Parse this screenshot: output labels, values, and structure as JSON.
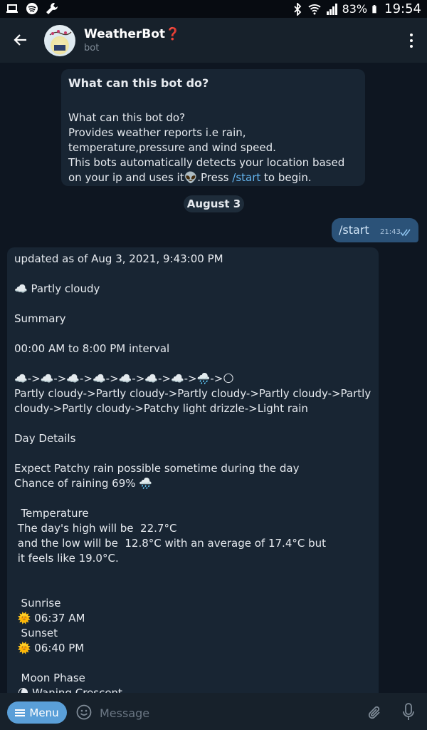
{
  "status_bar": {
    "battery_percent": "83%",
    "time": "19:54",
    "icons": [
      "laptop-icon",
      "spotify-icon",
      "wrench-icon",
      "bluetooth-icon",
      "wifi-icon",
      "signal-icon",
      "battery-icon"
    ]
  },
  "header": {
    "title": "WeatherBot❓",
    "subtitle": "bot",
    "icons": [
      "back-arrow-icon",
      "more-vert-icon"
    ]
  },
  "intro_card": {
    "title": "What can this bot do?",
    "body_before_link": "What can this bot do?\nProvides weather reports i.e rain, temperature,pressure and wind speed.\nThis bots automatically detects your location based on your ip and uses it👽.Press ",
    "link": "/start",
    "body_after_link": " to begin."
  },
  "date_separator": "August 3",
  "outgoing_message": {
    "text": "/start",
    "time": "21:43",
    "status": "read"
  },
  "incoming_message": {
    "text": "updated as of Aug 3, 2021, 9:43:00 PM\n\n☁️ Partly cloudy\n\nSummary\n\n00:00 AM to 8:00 PM interval\n\n☁️->☁️->☁️->☁️->☁️->☁️->☁️->🌧️->🌕\nPartly cloudy->Partly cloudy->Partly cloudy->Partly cloudy->Partly cloudy->Partly cloudy->Patchy light drizzle->Light rain\n\nDay Details\n\nExpect Patchy rain possible sometime during the day\nChance of raining 69% 🌧️\n\n  Temperature\n The day's high will be  22.7°C\n and the low will be  12.8°C with an average of 17.4°C but\n it feels like 19.0°C.\n\n\n  Sunrise\n 🌞 06:37 AM\n  Sunset\n 🌞 06:40 PM\n\n  Moon Phase\n 🌘 Waning Crescent"
  },
  "composer": {
    "menu_label": "Menu",
    "placeholder": "Message",
    "icons": [
      "menu-lines-icon",
      "emoji-icon",
      "attach-icon",
      "mic-icon"
    ]
  },
  "colors": {
    "background": "#0e1621",
    "header": "#17212b",
    "incoming_bubble": "#182533",
    "outgoing_bubble": "#2b5278",
    "accent": "#5a9fd8",
    "link": "#64b5ef"
  }
}
